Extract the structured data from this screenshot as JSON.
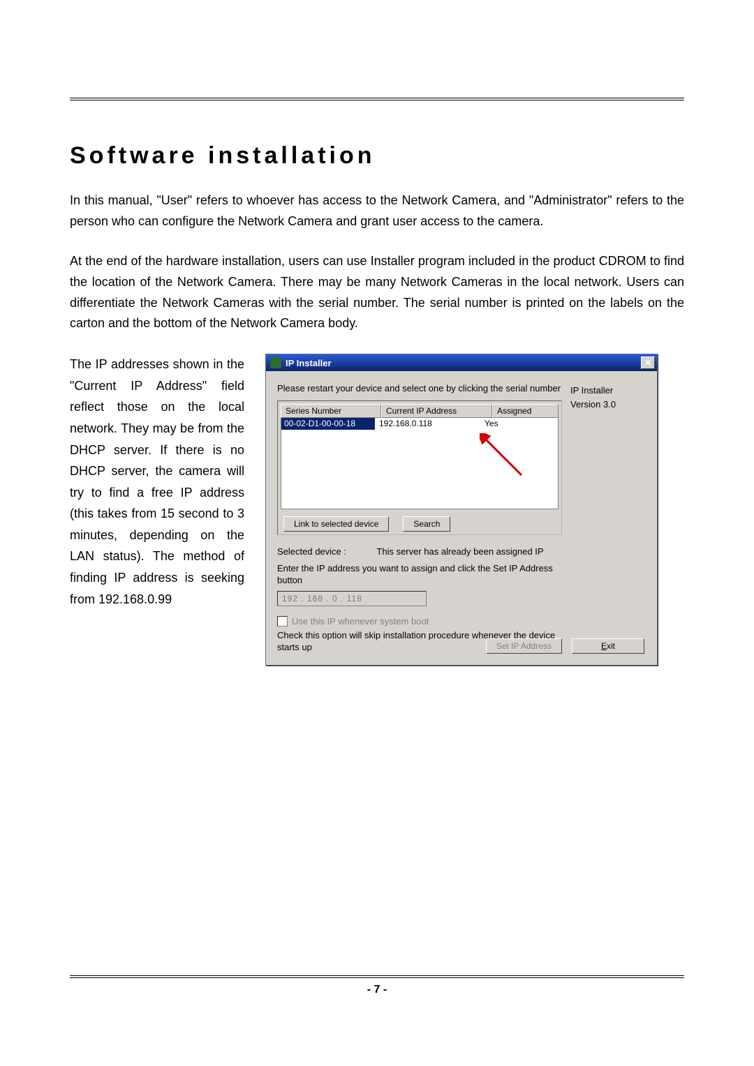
{
  "page_number": "- 7 -",
  "heading": "Software installation",
  "para1": "In this manual, \"User\" refers to whoever has access to the Network Camera, and \"Administrator\" refers to the person who can configure the Network Camera and grant user access to the camera.",
  "para2": "At the end of the hardware installation, users can use Installer program included in the product CDROM to find the location of the Network Camera. There may be many Network Cameras in the local network. Users can differentiate the Network Cameras with the serial number. The serial number is printed on the labels on the carton and the bottom of the Network Camera body.",
  "para3": "The IP addresses shown in the \"Current IP Address\" field reflect those on the local network. They may be from the DHCP server. If there is no DHCP server, the camera will try to find a free IP address (this takes from 15 second to 3 minutes, depending on the LAN status). The method of finding IP address is seeking from 192.168.0.99",
  "installer": {
    "title": "IP Installer",
    "instruction": "Please restart your device and select one by clicking the serial number",
    "columns": {
      "series": "Series Number",
      "ip": "Current IP Address",
      "assigned": "Assigned"
    },
    "row": {
      "series": "00-02-D1-00-00-18",
      "ip": "192.168.0.118",
      "assigned": "Yes"
    },
    "link_btn": "Link to selected device",
    "search_btn": "Search",
    "selected_label": "Selected device :",
    "selected_status": "This server has already been assigned IP",
    "enter_ip_instruction": "Enter the IP address you want to assign and click the Set IP Address button",
    "ip_value": "192 . 168 .   0  . 118",
    "use_ip_checkbox": "Use this IP whenever system boot",
    "skip_note": "Check this option will skip installation procedure whenever the device starts up",
    "set_ip_btn": "Set IP Address",
    "app_name": "IP Installer",
    "version": "Version 3.0",
    "exit_btn": "Exit"
  }
}
